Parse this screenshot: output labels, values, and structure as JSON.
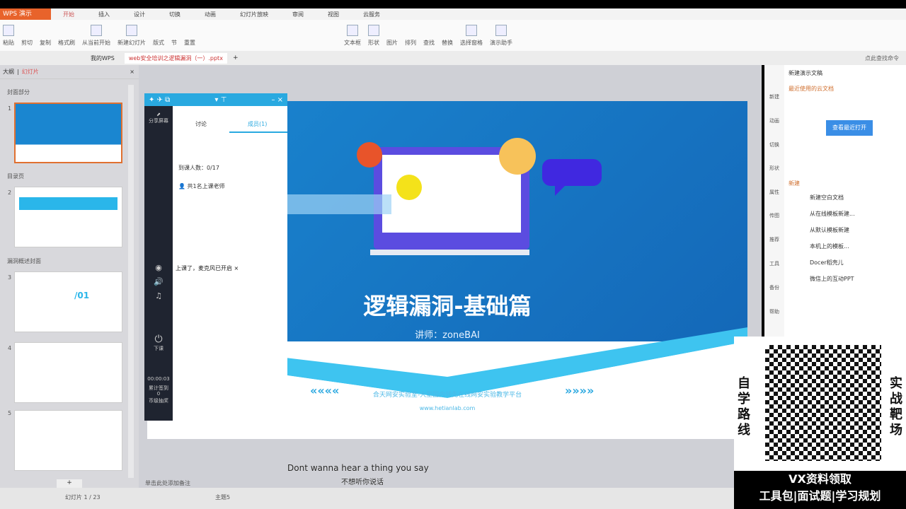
{
  "app": {
    "title": "WPS 演示"
  },
  "menu": [
    "开始",
    "插入",
    "设计",
    "切换",
    "动画",
    "幻灯片放映",
    "审阅",
    "视图",
    "云服务"
  ],
  "ribbon": [
    "粘贴",
    "剪切",
    "复制",
    "格式刷",
    "从当前开始",
    "新建幻灯片",
    "版式",
    "节",
    "重置",
    "文本框",
    "形状",
    "图片",
    "排列",
    "查找",
    "替换",
    "选择窗格",
    "演示助手"
  ],
  "tabs": {
    "home": "我的WPS",
    "doc": "web安全培训之逻辑漏洞（一）.pptx"
  },
  "left": {
    "header_outline": "大纲",
    "header_slides": "幻灯片",
    "sections": [
      "封面部分",
      "目录页",
      "漏洞概述封面"
    ],
    "slide_numbers": [
      "1",
      "2",
      "3",
      "4",
      "5"
    ],
    "slide3_label": "/01"
  },
  "slide": {
    "title": "逻辑漏洞-基础篇",
    "lecturer": "讲师：zoneBAI",
    "footer": "合天网安实验室-大型国内领先在线网安实验教学平台",
    "url": "www.hetianlab.com",
    "left_arrows": "««««",
    "right_arrows": "»»»»"
  },
  "panel": {
    "share_screen": "分享屏幕",
    "tab_discuss": "讨论",
    "tab_members": "成员(1)",
    "attendance": "到课人数：0/17",
    "teacher": "共1名上课老师",
    "toast": "上课了，麦克风已开启",
    "end_class": "下课",
    "timer": "00:00:03",
    "stat1": "累计签到",
    "stat2": "0",
    "stat3": "币级抽奖"
  },
  "right": {
    "dropdown": "新建演示文稿",
    "recent": "最近使用的云文档",
    "open_recent": "查看最近打开",
    "new_heading": "新建",
    "items": [
      "新建空白文档",
      "从在线模板新建...",
      "从默认模板新建",
      "本机上的模板...",
      "Docer稻壳儿",
      "微信上的互动PPT"
    ],
    "side": [
      "新建",
      "动画",
      "切换",
      "形状",
      "属性",
      "传图",
      "推荐",
      "工具",
      "备份",
      "帮助"
    ],
    "search": "点此查找命令"
  },
  "promo": {
    "left": [
      "自",
      "学",
      "路",
      "线"
    ],
    "right": [
      "实",
      "战",
      "靶",
      "场"
    ],
    "line1": "VX资料领取",
    "line2": "工具包|面试题|学习规划"
  },
  "status": {
    "notes": "单击此处添加备注",
    "slide_count": "幻灯片 1 / 23",
    "theme": "主题5"
  },
  "subtitles": {
    "en": "Dont wanna hear a thing you say",
    "zh": "不想听你说话"
  }
}
